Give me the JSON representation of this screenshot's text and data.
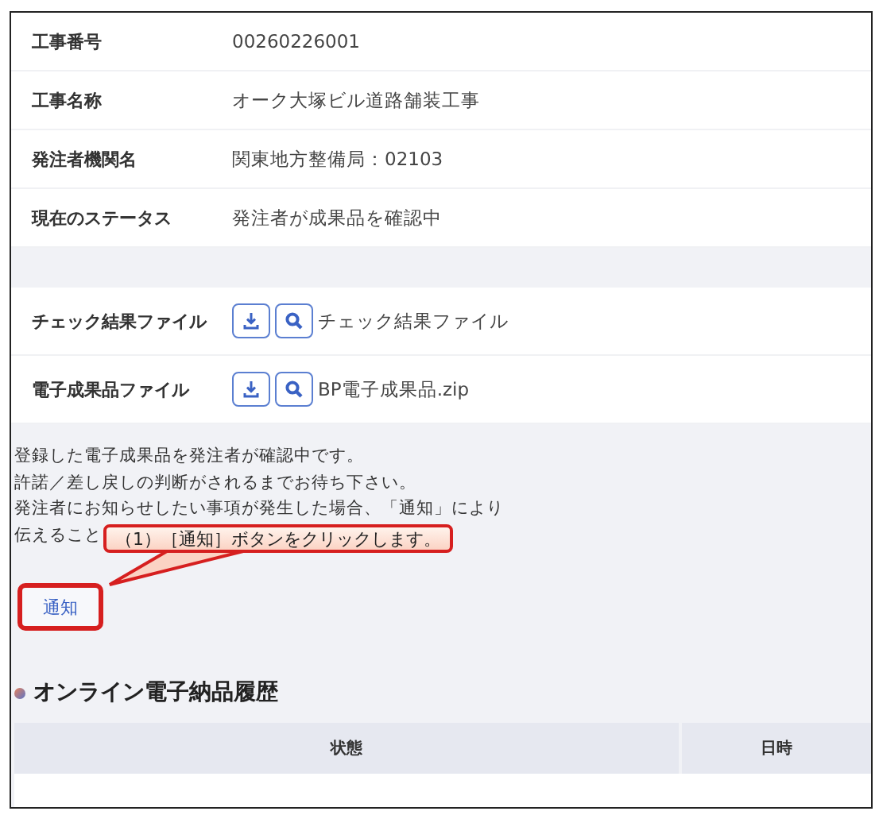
{
  "details": [
    {
      "label": "工事番号",
      "value": "00260226001"
    },
    {
      "label": "工事名称",
      "value": "オーク大塚ビル道路舗装工事"
    },
    {
      "label": "発注者機関名",
      "value": "関東地方整備局：02103"
    },
    {
      "label": "現在のステータス",
      "value": "発注者が成果品を確認中"
    }
  ],
  "files": [
    {
      "label": "チェック結果ファイル",
      "file": "チェック結果ファイル"
    },
    {
      "label": "電子成果品ファイル",
      "file": "BP電子成果品.zip"
    }
  ],
  "message_lines": [
    "登録した電子成果品を発注者が確認中です。",
    "許諾／差し戻しの判断がされるまでお待ち下さい。",
    "発注者にお知らせしたい事項が発生した場合、「通知」により",
    "伝えること"
  ],
  "notify_button": "通知",
  "callout": "（1）［通知］ボタンをクリックします。",
  "history": {
    "title": "オンライン電子納品履歴",
    "columns": [
      "状態",
      "日時"
    ]
  }
}
